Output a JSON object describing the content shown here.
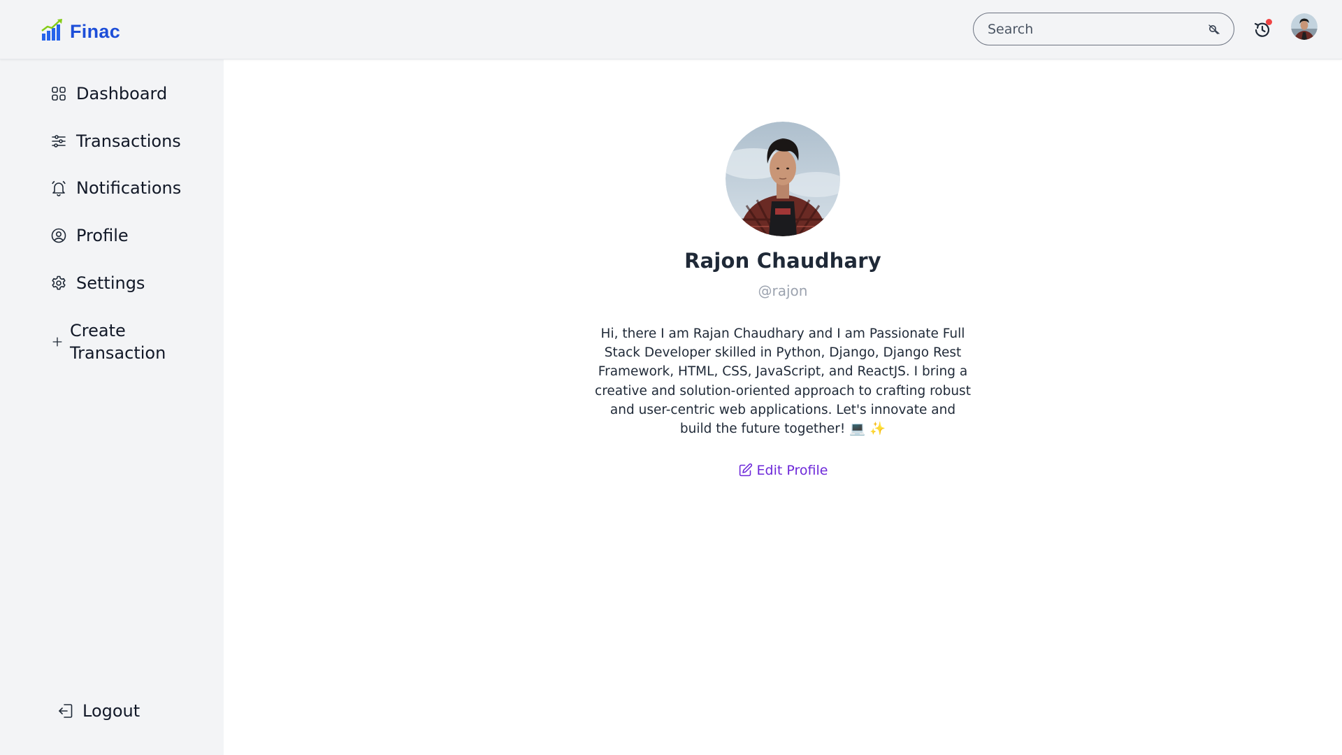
{
  "brand": {
    "name": "Finac",
    "icon": "bar-chart-growth-icon",
    "color": "#1d4ed8"
  },
  "header": {
    "search": {
      "placeholder": "Search",
      "value": ""
    },
    "history_icon": "clock-history-icon",
    "has_notification": true,
    "notification_dot_color": "#ef4444",
    "avatar_icon": "user-avatar"
  },
  "sidebar": {
    "items": [
      {
        "label": "Dashboard",
        "icon": "grid-icon"
      },
      {
        "label": "Transactions",
        "icon": "sliders-icon"
      },
      {
        "label": "Notifications",
        "icon": "bell-icon"
      },
      {
        "label": "Profile",
        "icon": "user-circle-icon"
      },
      {
        "label": "Settings",
        "icon": "gear-icon"
      },
      {
        "label": "Create Transaction",
        "icon": "plus-icon"
      }
    ],
    "logout": {
      "label": "Logout",
      "icon": "logout-icon"
    }
  },
  "profile": {
    "name": "Rajon Chaudhary",
    "username": "@rajon",
    "bio": "Hi, there I am Rajan Chaudhary and I am Passionate Full Stack Developer skilled in Python, Django, Django Rest Framework, HTML, CSS, JavaScript, and ReactJS. I bring a creative and solution-oriented approach to crafting robust and user-centric web applications. Let's innovate and build the future together! 💻 ✨",
    "edit_label": "Edit Profile",
    "edit_icon": "edit-pencil-icon",
    "link_color": "#6d28d9"
  }
}
